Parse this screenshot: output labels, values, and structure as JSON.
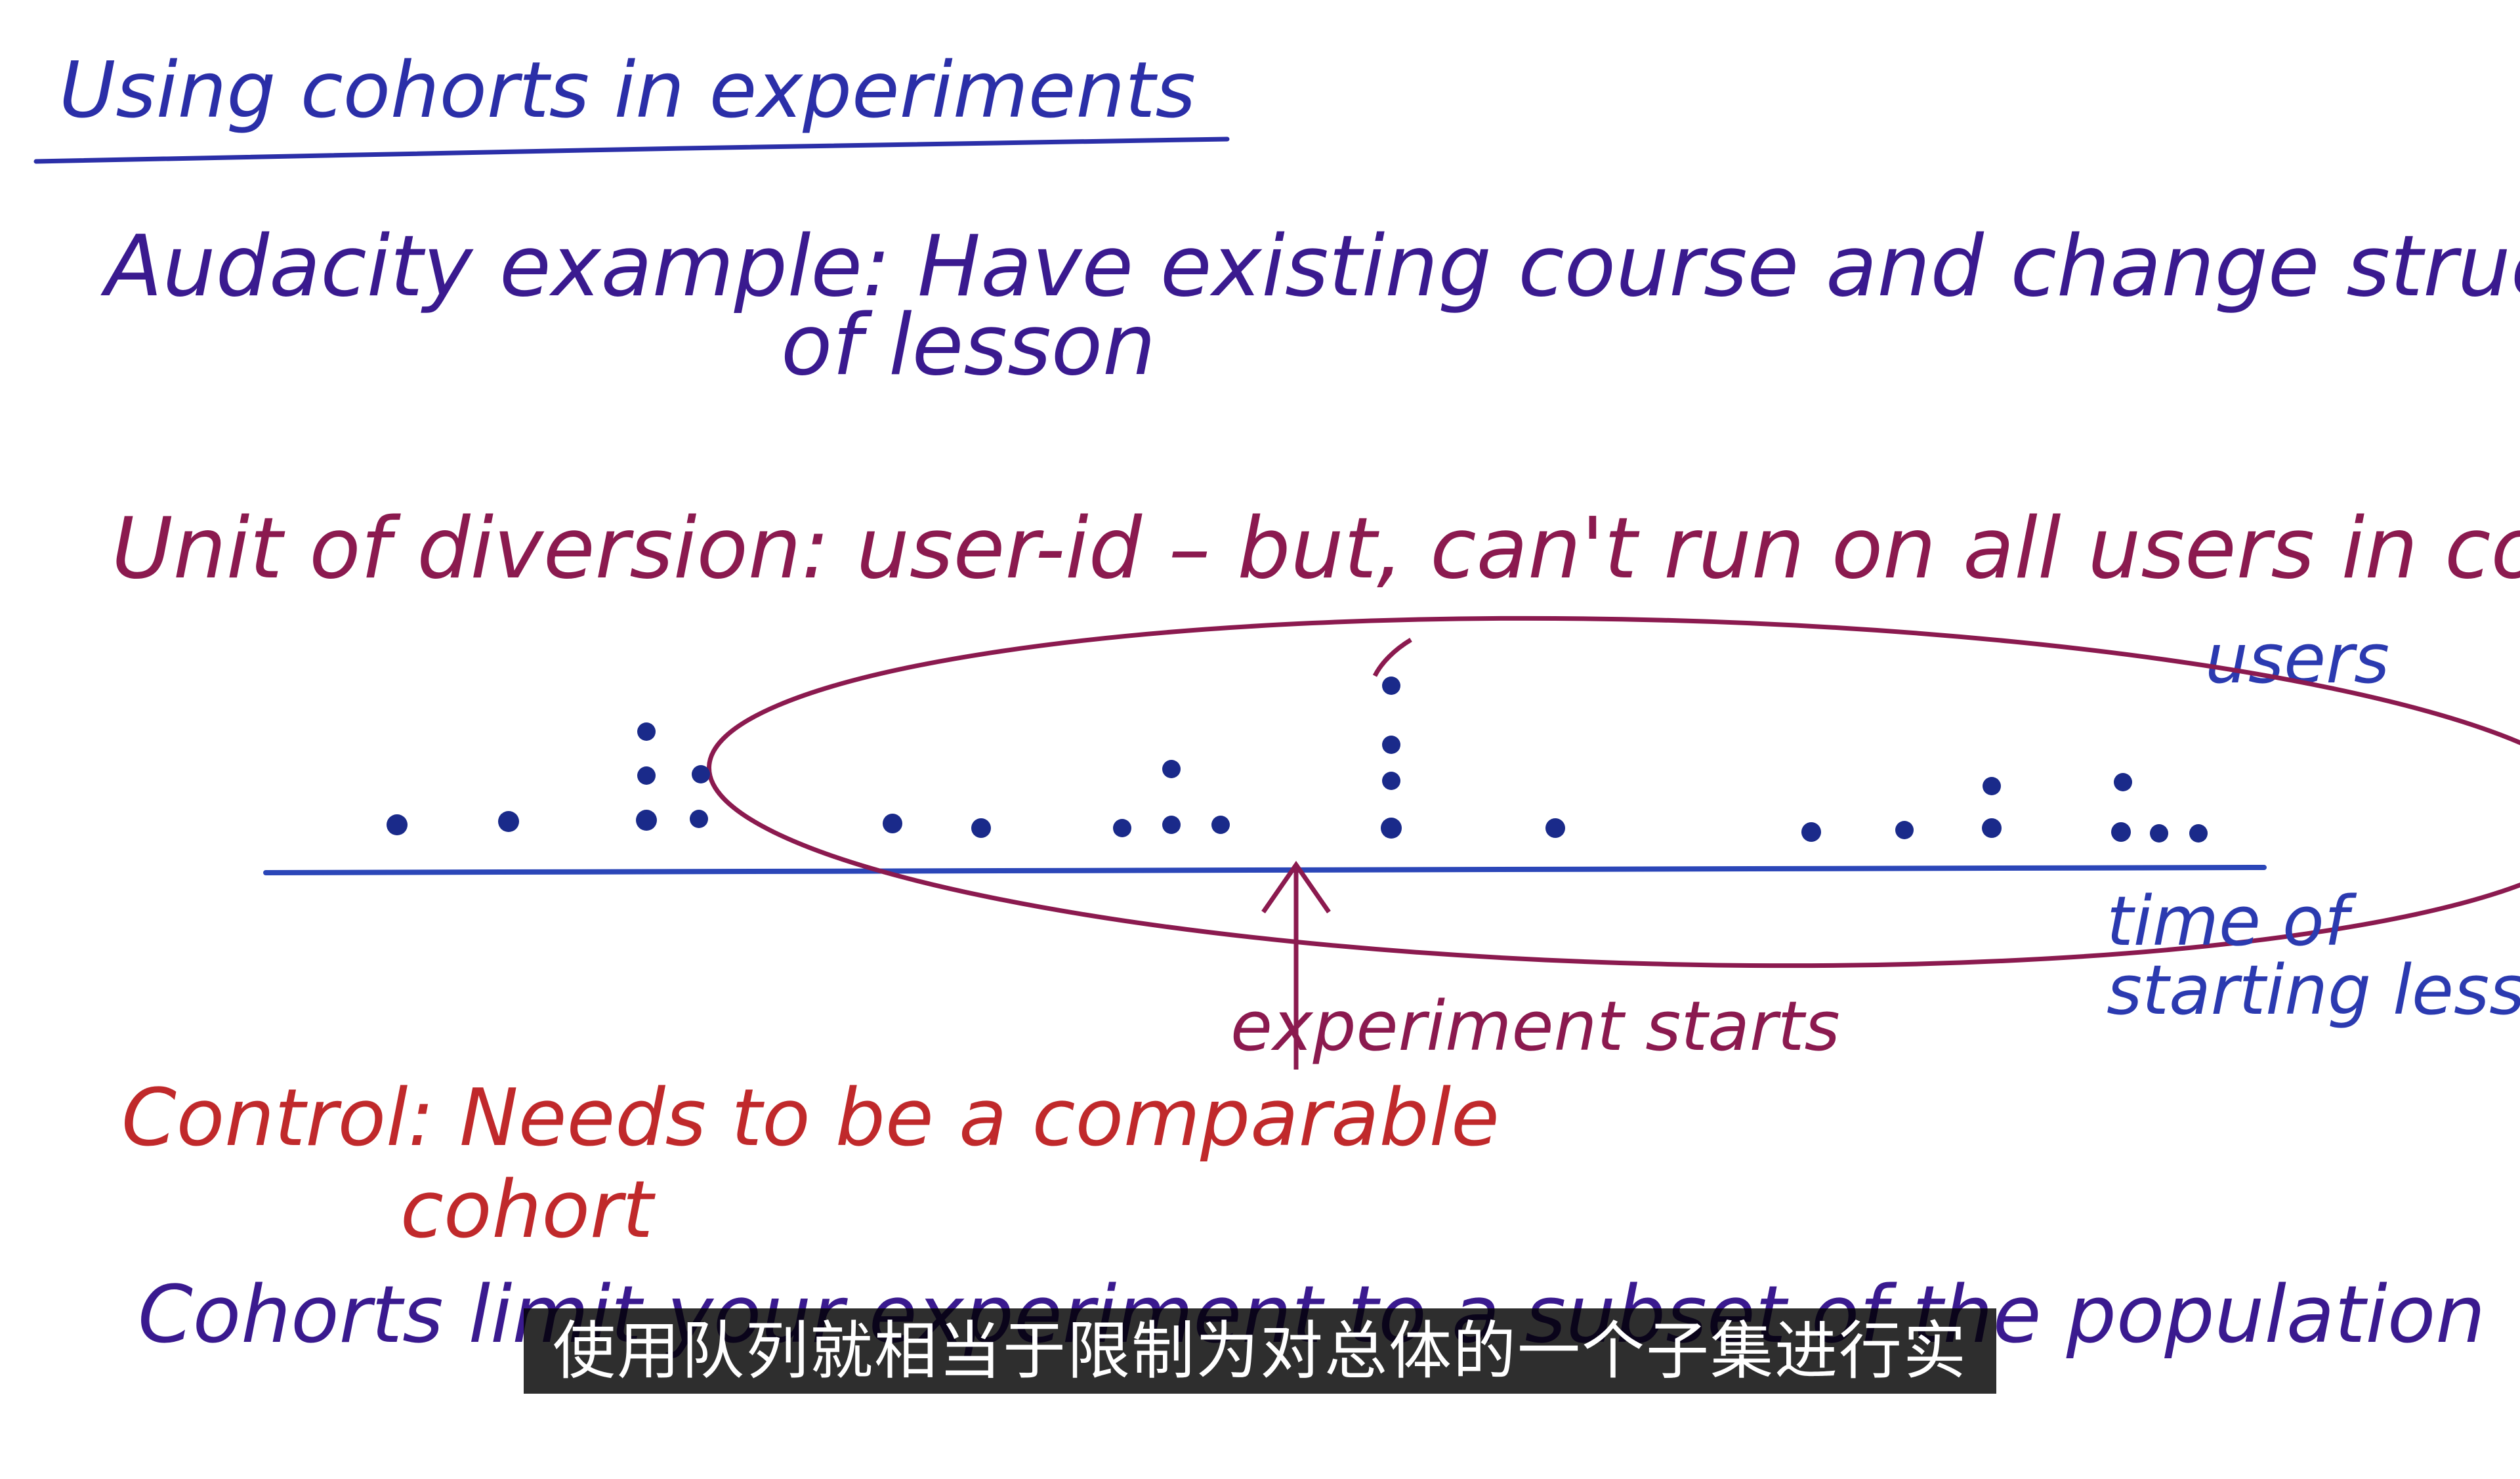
{
  "colors": {
    "title": "#2b2fa8",
    "audacity": "#3a1a8f",
    "unit": "#8b1a4f",
    "control": "#c0292b",
    "cohorts": "#3a1a8f",
    "timeline": "#2b46b8",
    "dots": "#1a2a8a",
    "ellipse": "#8b1a4f",
    "labels_blue": "#2b3ab0",
    "subtitle_bg": "#000000",
    "subtitle_text": "#ffffff"
  },
  "title": "Using cohorts in experiments",
  "audacity": {
    "line1": "Audacity example: Have existing course and change structure",
    "line2": "of lesson"
  },
  "unit": {
    "text": "Unit of diversion: user-id  –  but, can't run on all users in course"
  },
  "diagram": {
    "users_label": "users",
    "experiment_label": "experiment starts",
    "axis_label_line1": "time of",
    "axis_label_line2": "starting lesson"
  },
  "control": {
    "line1": "Control: Needs to be a comparable",
    "line2": "cohort"
  },
  "cohorts_line": "Cohorts limit your experiment to a subset of the population",
  "subtitle": "使用队列就相当于限制为对总体的一个子集进行实验"
}
